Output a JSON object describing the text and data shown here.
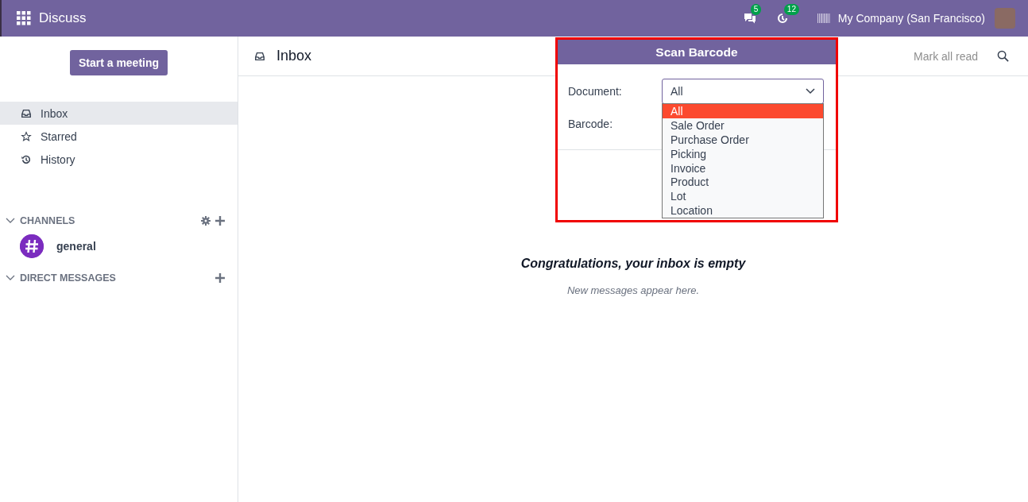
{
  "navbar": {
    "app_name": "Discuss",
    "messages_count": "5",
    "activities_count": "12",
    "company": "My Company (San Francisco)"
  },
  "sidebar": {
    "start_button": "Start a meeting",
    "items": [
      {
        "label": "Inbox",
        "kind": "inbox",
        "selected": true
      },
      {
        "label": "Starred",
        "kind": "star",
        "selected": false
      },
      {
        "label": "History",
        "kind": "history",
        "selected": false
      }
    ],
    "channels_header": "CHANNELS",
    "channels": [
      {
        "name": "general"
      }
    ],
    "direct_messages_header": "DIRECT MESSAGES"
  },
  "main": {
    "title": "Inbox",
    "mark_all_read": "Mark all read",
    "empty_title": "Congratulations, your inbox is empty",
    "empty_subtitle": "New messages appear here."
  },
  "scan_popup": {
    "title": "Scan Barcode",
    "document_label": "Document:",
    "document_value": "All",
    "barcode_label": "Barcode:",
    "options": [
      {
        "label": "All",
        "selected": true
      },
      {
        "label": "Sale Order",
        "selected": false
      },
      {
        "label": "Purchase Order",
        "selected": false
      },
      {
        "label": "Picking",
        "selected": false
      },
      {
        "label": "Invoice",
        "selected": false
      },
      {
        "label": "Product",
        "selected": false
      },
      {
        "label": "Lot",
        "selected": false
      },
      {
        "label": "Location",
        "selected": false
      }
    ]
  }
}
